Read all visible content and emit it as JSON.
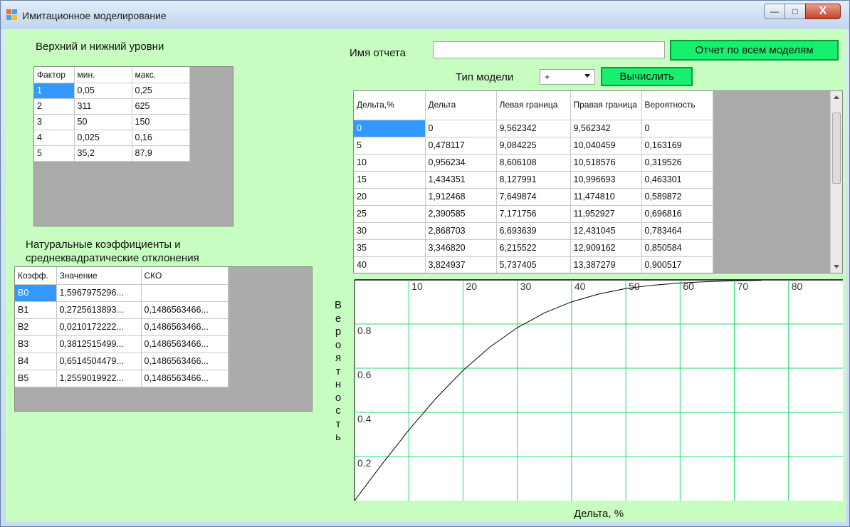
{
  "window": {
    "title": "Имитационное моделирование",
    "buttons": {
      "minimize": "—",
      "maximize": "□",
      "close": "X"
    }
  },
  "levels": {
    "heading": "Верхний и нижний уровни",
    "columns": [
      "Фактор",
      "мин.",
      "макс."
    ],
    "rows": [
      [
        "1",
        "0,05",
        "0,25"
      ],
      [
        "2",
        "311",
        "625"
      ],
      [
        "3",
        "50",
        "150"
      ],
      [
        "4",
        "0,025",
        "0,16"
      ],
      [
        "5",
        "35,2",
        "87,9"
      ]
    ]
  },
  "coefs": {
    "heading_line1": "Натуральные коэффициенты и",
    "heading_line2": "среднеквадратические отклонения",
    "columns": [
      "Коэфф.",
      "Значение",
      "СКО"
    ],
    "rows": [
      [
        "B0",
        "1,5967975296...",
        ""
      ],
      [
        "B1",
        "0,2725613893...",
        "0,1486563466..."
      ],
      [
        "B2",
        "0,0210172222...",
        "0,1486563466..."
      ],
      [
        "B3",
        "0,3812515499...",
        "0,1486563466..."
      ],
      [
        "B4",
        "0,6514504479...",
        "0,1486563466..."
      ],
      [
        "B5",
        "1,2559019922...",
        "0,1486563466..."
      ]
    ]
  },
  "report": {
    "label": "Имя отчета",
    "value": "",
    "button": "Отчет по всем моделям"
  },
  "model": {
    "label": "Тип модели",
    "selected": "+",
    "compute_button": "Вычислить"
  },
  "results": {
    "columns": [
      "Дельта,%",
      "Дельта",
      "Левая граница",
      "Правая граница",
      "Вероятность"
    ],
    "rows": [
      [
        "0",
        "0",
        "9,562342",
        "9,562342",
        "0"
      ],
      [
        "5",
        "0,478117",
        "9,084225",
        "10,040459",
        "0,163169"
      ],
      [
        "10",
        "0,956234",
        "8,606108",
        "10,518576",
        "0,319526"
      ],
      [
        "15",
        "1,434351",
        "8,127991",
        "10,996693",
        "0,463301"
      ],
      [
        "20",
        "1,912468",
        "7,649874",
        "11,474810",
        "0,589872"
      ],
      [
        "25",
        "2,390585",
        "7,171756",
        "11,952927",
        "0,696816"
      ],
      [
        "30",
        "2,868703",
        "6,693639",
        "12,431045",
        "0,783464"
      ],
      [
        "35",
        "3,346820",
        "6,215522",
        "12,909162",
        "0,850584"
      ],
      [
        "40",
        "3,824937",
        "5,737405",
        "13,387279",
        "0,900517"
      ]
    ]
  },
  "chart_data": {
    "type": "line",
    "title": "",
    "xlabel": "Дельта, %",
    "ylabel": "Вероятность",
    "xlim": [
      0,
      90
    ],
    "ylim": [
      0,
      1
    ],
    "x_ticks": [
      10,
      20,
      30,
      40,
      50,
      60,
      70,
      80
    ],
    "y_ticks": [
      0.2,
      0.4,
      0.6,
      0.8
    ],
    "y_tick_labels": [
      "0.2",
      "0.4",
      "0.6",
      "0.8"
    ],
    "grid": true,
    "grid_color": "#1fdc6a",
    "line_color": "#000000",
    "series": [
      {
        "x": [
          0,
          5,
          10,
          15,
          20,
          25,
          30,
          35,
          40,
          45,
          50,
          55,
          60,
          65,
          70,
          75
        ],
        "values": [
          0,
          0.163169,
          0.319526,
          0.463301,
          0.589872,
          0.696816,
          0.783464,
          0.850584,
          0.900517,
          0.936,
          0.961,
          0.976,
          0.986,
          0.992,
          0.996,
          0.998
        ]
      }
    ]
  },
  "colors": {
    "background": "#c7fdc1",
    "button_green": "#16f06e",
    "selection": "#3399ff",
    "grid_gray": "#ababab"
  }
}
